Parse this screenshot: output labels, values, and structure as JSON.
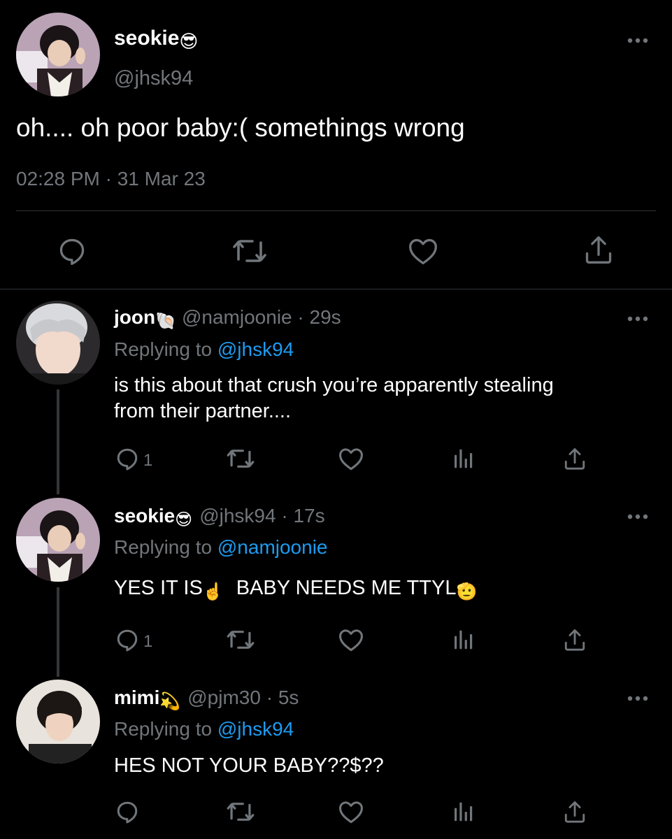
{
  "main_tweet": {
    "display_name": "seokie",
    "name_emoji": "😎",
    "handle": "@jhsk94",
    "text": "oh.... oh poor baby:( somethings wrong",
    "timestamp": "02:28 PM · 31 Mar 23",
    "avatar_icon": "avatar-seokie"
  },
  "replies": [
    {
      "display_name": "joon",
      "name_emoji": "🐚",
      "meta": "@namjoonie · 29s",
      "replying_prefix": "Replying to",
      "replying_to": "@jhsk94",
      "text_line1": "is this about that crush you’re apparently stealing",
      "text_line2": "from their partner....",
      "reply_count": "1"
    },
    {
      "display_name": "seokie",
      "name_emoji": "😎",
      "meta": "@jhsk94 · 17s",
      "replying_prefix": "Replying to",
      "replying_to": "@namjoonie",
      "text_part1": "YES IT IS",
      "emoji1": "☝️",
      "text_part2": "BABY NEEDS ME TTYL",
      "emoji2": "🫡",
      "reply_count": "1"
    },
    {
      "display_name": "mimi",
      "name_emoji": "💫",
      "meta": "@pjm30 · 5s",
      "replying_prefix": "Replying to",
      "replying_to": "@jhsk94",
      "text": "HES NOT YOUR BABY??$??",
      "reply_count": ""
    }
  ],
  "colors": {
    "background": "#000000",
    "text": "#ffffff",
    "secondary": "#71767b",
    "link": "#1d9bf0",
    "divider": "#2f3336"
  }
}
